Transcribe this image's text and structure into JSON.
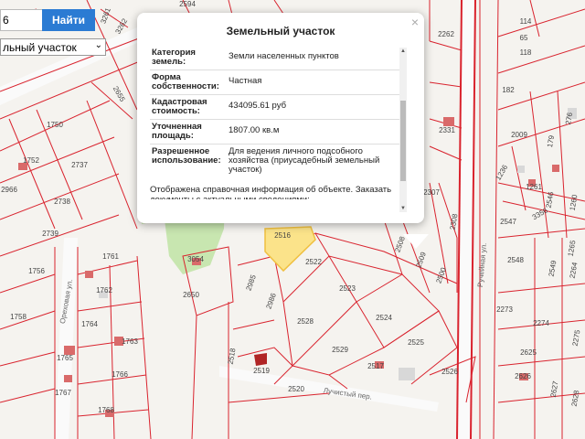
{
  "search": {
    "value": "6",
    "button_label": "Найти"
  },
  "layer": {
    "selected": "льный участок"
  },
  "popup": {
    "title": "Земельный участок",
    "rows": [
      {
        "key": "Категория земель:",
        "value": "Земли населенных пунктов"
      },
      {
        "key": "Форма собственности:",
        "value": "Частная"
      },
      {
        "key": "Кадастровая стоимость:",
        "value": "434095.61 руб"
      },
      {
        "key": "Уточненная площадь:",
        "value": "1807.00 кв.м"
      },
      {
        "key": "Разрешенное использование:",
        "value": "Для ведения личного подсобного хозяйства (приусадебный земельный участок)"
      }
    ],
    "note": "Отображена справочная информация об объекте. Заказать документы с актуальными сведениями:",
    "close": "×"
  },
  "map": {
    "parcel_labels": [
      "2594",
      "2262",
      "3261",
      "3262",
      "2655",
      "1750",
      "1752",
      "2737",
      "2966",
      "2738",
      "2739",
      "1756",
      "1761",
      "1762",
      "1758",
      "1764",
      "1763",
      "1765",
      "1766",
      "1767",
      "1768",
      "3054",
      "2650",
      "2516",
      "2522",
      "2985",
      "2986",
      "2523",
      "2528",
      "2524",
      "2529",
      "2525",
      "2518",
      "2519",
      "2520",
      "2517",
      "2526",
      "2508",
      "2509",
      "2500",
      "2308",
      "2307",
      "2331",
      "2009",
      "179",
      "276",
      "1236",
      "1261",
      "1260",
      "3356",
      "2547",
      "2548",
      "2549",
      "2273",
      "2274",
      "2625",
      "2626",
      "2627",
      "2628",
      "182",
      "114",
      "65",
      "118",
      "2546",
      "2275",
      "1265",
      "2264"
    ],
    "street_labels": [
      "Ореховая ул.",
      "Лучистый пер.",
      "Ручейная ул."
    ],
    "colors": {
      "parcel_line": "#d9232e",
      "highlight_fill": "#fbe38a",
      "green_zone": "#c8e6b0",
      "road": "#f8f8f8",
      "building": "#d96a6a"
    }
  }
}
